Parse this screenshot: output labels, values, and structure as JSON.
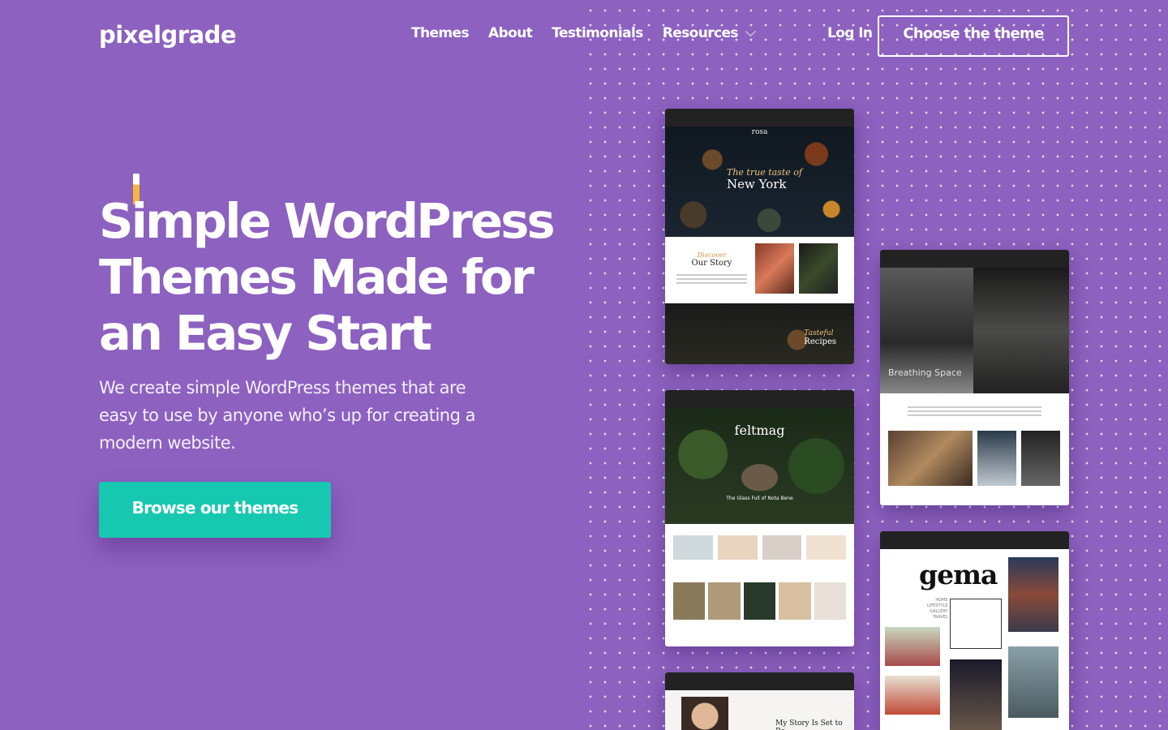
{
  "header": {
    "logo": "pixelgrade",
    "nav": [
      "Themes",
      "About",
      "Testimonials",
      "Resources"
    ],
    "login": "Log In",
    "cta": "Choose the theme"
  },
  "hero": {
    "title": "Simple WordPress Themes Made for an Easy Start",
    "subtitle": "We create simple WordPress themes that are easy to use by anyone who’s up for creating a modern website.",
    "button": "Browse our themes"
  },
  "previews": {
    "rosa": {
      "brand": "rosa",
      "headline_script": "The true taste of",
      "headline": "New York",
      "section1_script": "Discover",
      "section1": "Our Story",
      "section2_script": "Tasteful",
      "section2": "Recipes"
    },
    "felt": {
      "brand": "feltmag",
      "caption": "The Glass Full of Nota Bene"
    },
    "breathing": {
      "title": "Breathing Space"
    },
    "gema": {
      "brand": "gema",
      "menu": "HOME\nLIFESTYLE\nGALLERY\nTRAVEL"
    },
    "story": {
      "title": "My Story Is Set to Be"
    }
  },
  "colors": {
    "background": "#8c61bf",
    "accent": "#17c8b0",
    "caret": "#f4b63b"
  }
}
